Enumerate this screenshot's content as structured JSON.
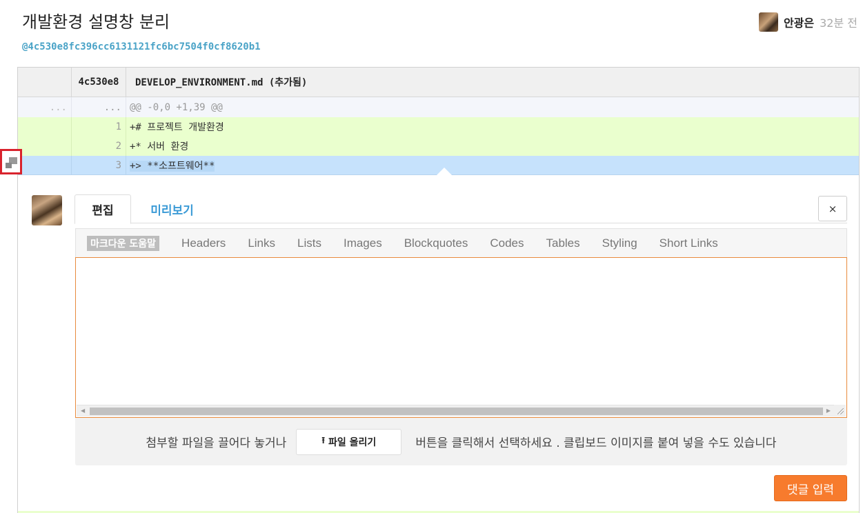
{
  "page": {
    "title": "개발환경 설명창 분리",
    "commit_ref": "@4c530e8fc396cc6131121fc6bc7504f0cf8620b1",
    "author_name": "안광은",
    "author_time": "32분 전"
  },
  "diff": {
    "short_hash": "4c530e8",
    "file_label": "DEVELOP_ENVIRONMENT.md (추가됨)",
    "hunk": {
      "ln1": "...",
      "ln2": "...",
      "code": "@@ -0,0 +1,39 @@"
    },
    "lines": [
      {
        "num": "1",
        "code": "+# 프로젝트 개발환경"
      },
      {
        "num": "2",
        "code": "+* 서버 환경"
      },
      {
        "num": "3",
        "code": "+> **소프트웨어**"
      }
    ]
  },
  "editor": {
    "tab_edit": "편집",
    "tab_preview": "미리보기",
    "close_label": "×",
    "md_help": "마크다운 도움말",
    "toolbar_items": [
      "Headers",
      "Links",
      "Lists",
      "Images",
      "Blockquotes",
      "Codes",
      "Tables",
      "Styling",
      "Short Links"
    ],
    "textarea_value": "",
    "upload_prefix": "첨부할 파일을 끌어다 놓거나",
    "upload_button": "파일 올리기",
    "upload_suffix": "버튼을 클릭해서 선택하세요 . 클립보드 이미지를 붙여 넣을 수도 있습니다",
    "submit_label": "댓글 입력"
  },
  "colors": {
    "accent": "#f77b2d",
    "link": "#4aa3c7",
    "added_line_bg": "#eaffce",
    "selected_line_bg": "#c6e2fc",
    "marker_border": "#d9232d"
  },
  "icons": {
    "comment_marker": "comment-icon",
    "upload": "upload-icon",
    "close": "close-icon"
  }
}
